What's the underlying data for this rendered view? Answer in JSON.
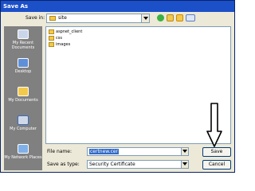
{
  "window": {
    "title": "Save As"
  },
  "lookin": {
    "label": "Save in:",
    "value": "site"
  },
  "toolbar": {
    "icons": [
      "back-icon",
      "up-folder-icon",
      "new-folder-icon",
      "views-icon"
    ]
  },
  "places": [
    {
      "label": "My Recent Documents",
      "icon": "recent-documents-icon"
    },
    {
      "label": "Desktop",
      "icon": "desktop-icon"
    },
    {
      "label": "My Documents",
      "icon": "my-documents-icon"
    },
    {
      "label": "My Computer",
      "icon": "my-computer-icon"
    },
    {
      "label": "My Network Places",
      "icon": "network-places-icon"
    }
  ],
  "files": [
    {
      "name": "aspnet_client"
    },
    {
      "name": "css"
    },
    {
      "name": "images"
    }
  ],
  "filename": {
    "label": "File name:",
    "value": "certnew.cer"
  },
  "filetype": {
    "label": "Save as type:",
    "value": "Security Certificate"
  },
  "buttons": {
    "save": "Save",
    "cancel": "Cancel"
  }
}
